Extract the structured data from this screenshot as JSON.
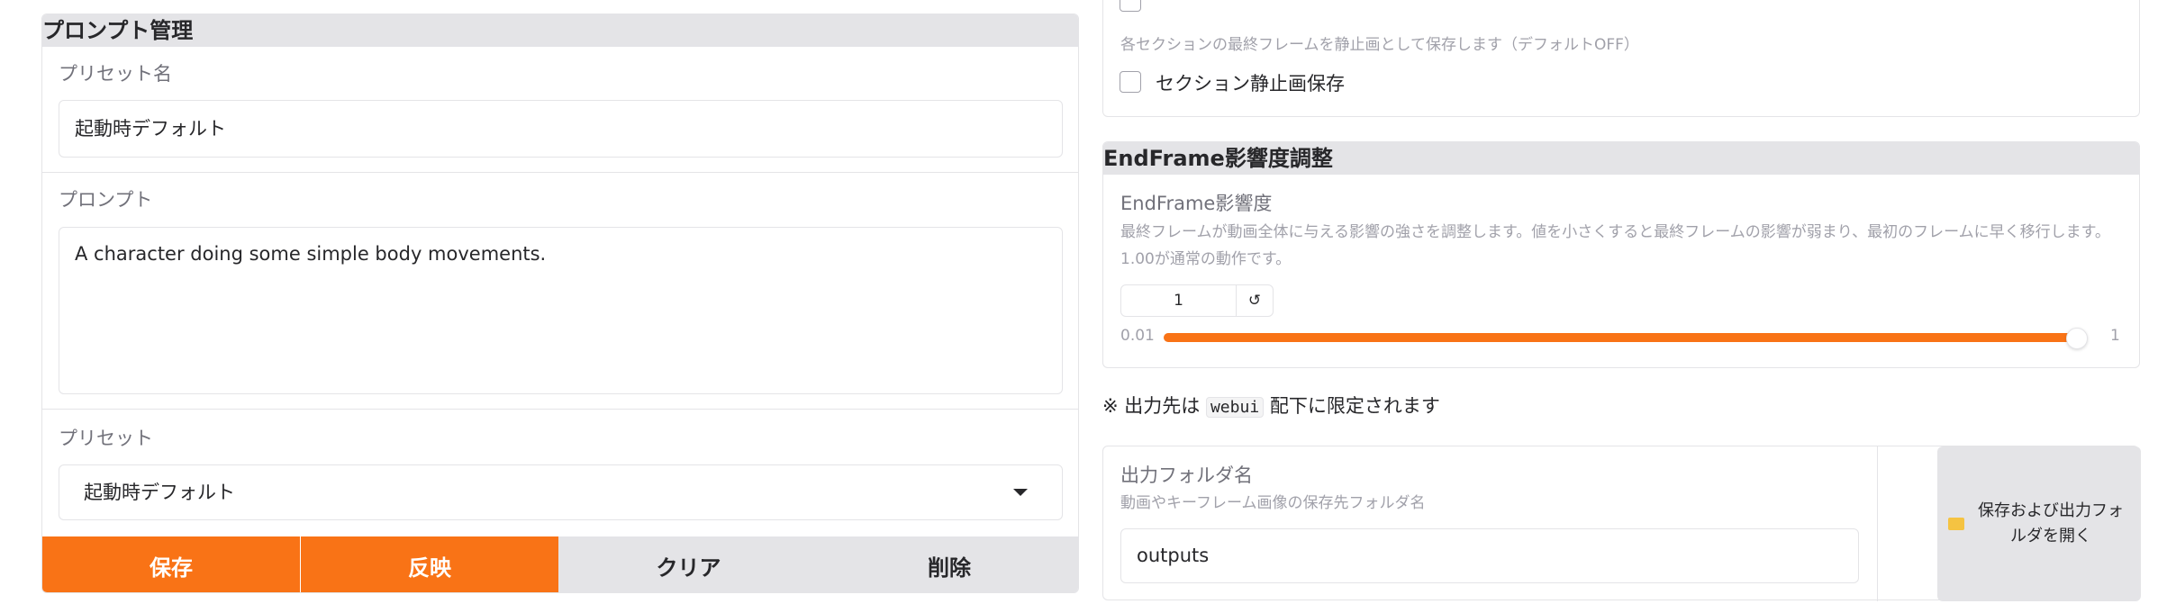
{
  "prompt_management": {
    "title": "プロンプト管理",
    "preset_name_label": "プリセット名",
    "preset_name_value": "起動時デフォルト",
    "prompt_label": "プロンプト",
    "prompt_value": "A character doing some simple body movements.",
    "preset_label": "プリセット",
    "preset_selected": "起動時デフォルト",
    "buttons": {
      "save": "保存",
      "apply": "反映",
      "clear": "クリア",
      "delete": "削除"
    }
  },
  "section_still": {
    "info": "各セクションの最終フレームを静止画として保存します（デフォルトOFF）",
    "checkbox_label": "セクション静止画保存",
    "checked": false
  },
  "endframe": {
    "title": "EndFrame影響度調整",
    "label": "EndFrame影響度",
    "info": "最終フレームが動画全体に与える影響の強さを調整します。値を小さくすると最終フレームの影響が弱まり、最初のフレームに早く移行します。1.00が通常の動作です。",
    "value": "1",
    "min": "0.01",
    "max": "1",
    "reset_icon": "↺",
    "fill_fraction": 1.0
  },
  "output_note": {
    "prefix": "※ 出力先は",
    "code": "webui",
    "suffix": "配下に限定されます"
  },
  "output_folder": {
    "label": "出力フォルダ名",
    "info": "動画やキーフレーム画像の保存先フォルダ名",
    "value": "outputs",
    "open_button": "保存および出力フォルダを開く",
    "folder_icon": "folder-icon"
  },
  "colors": {
    "accent": "#f97316",
    "secondary": "#e4e4e7"
  }
}
